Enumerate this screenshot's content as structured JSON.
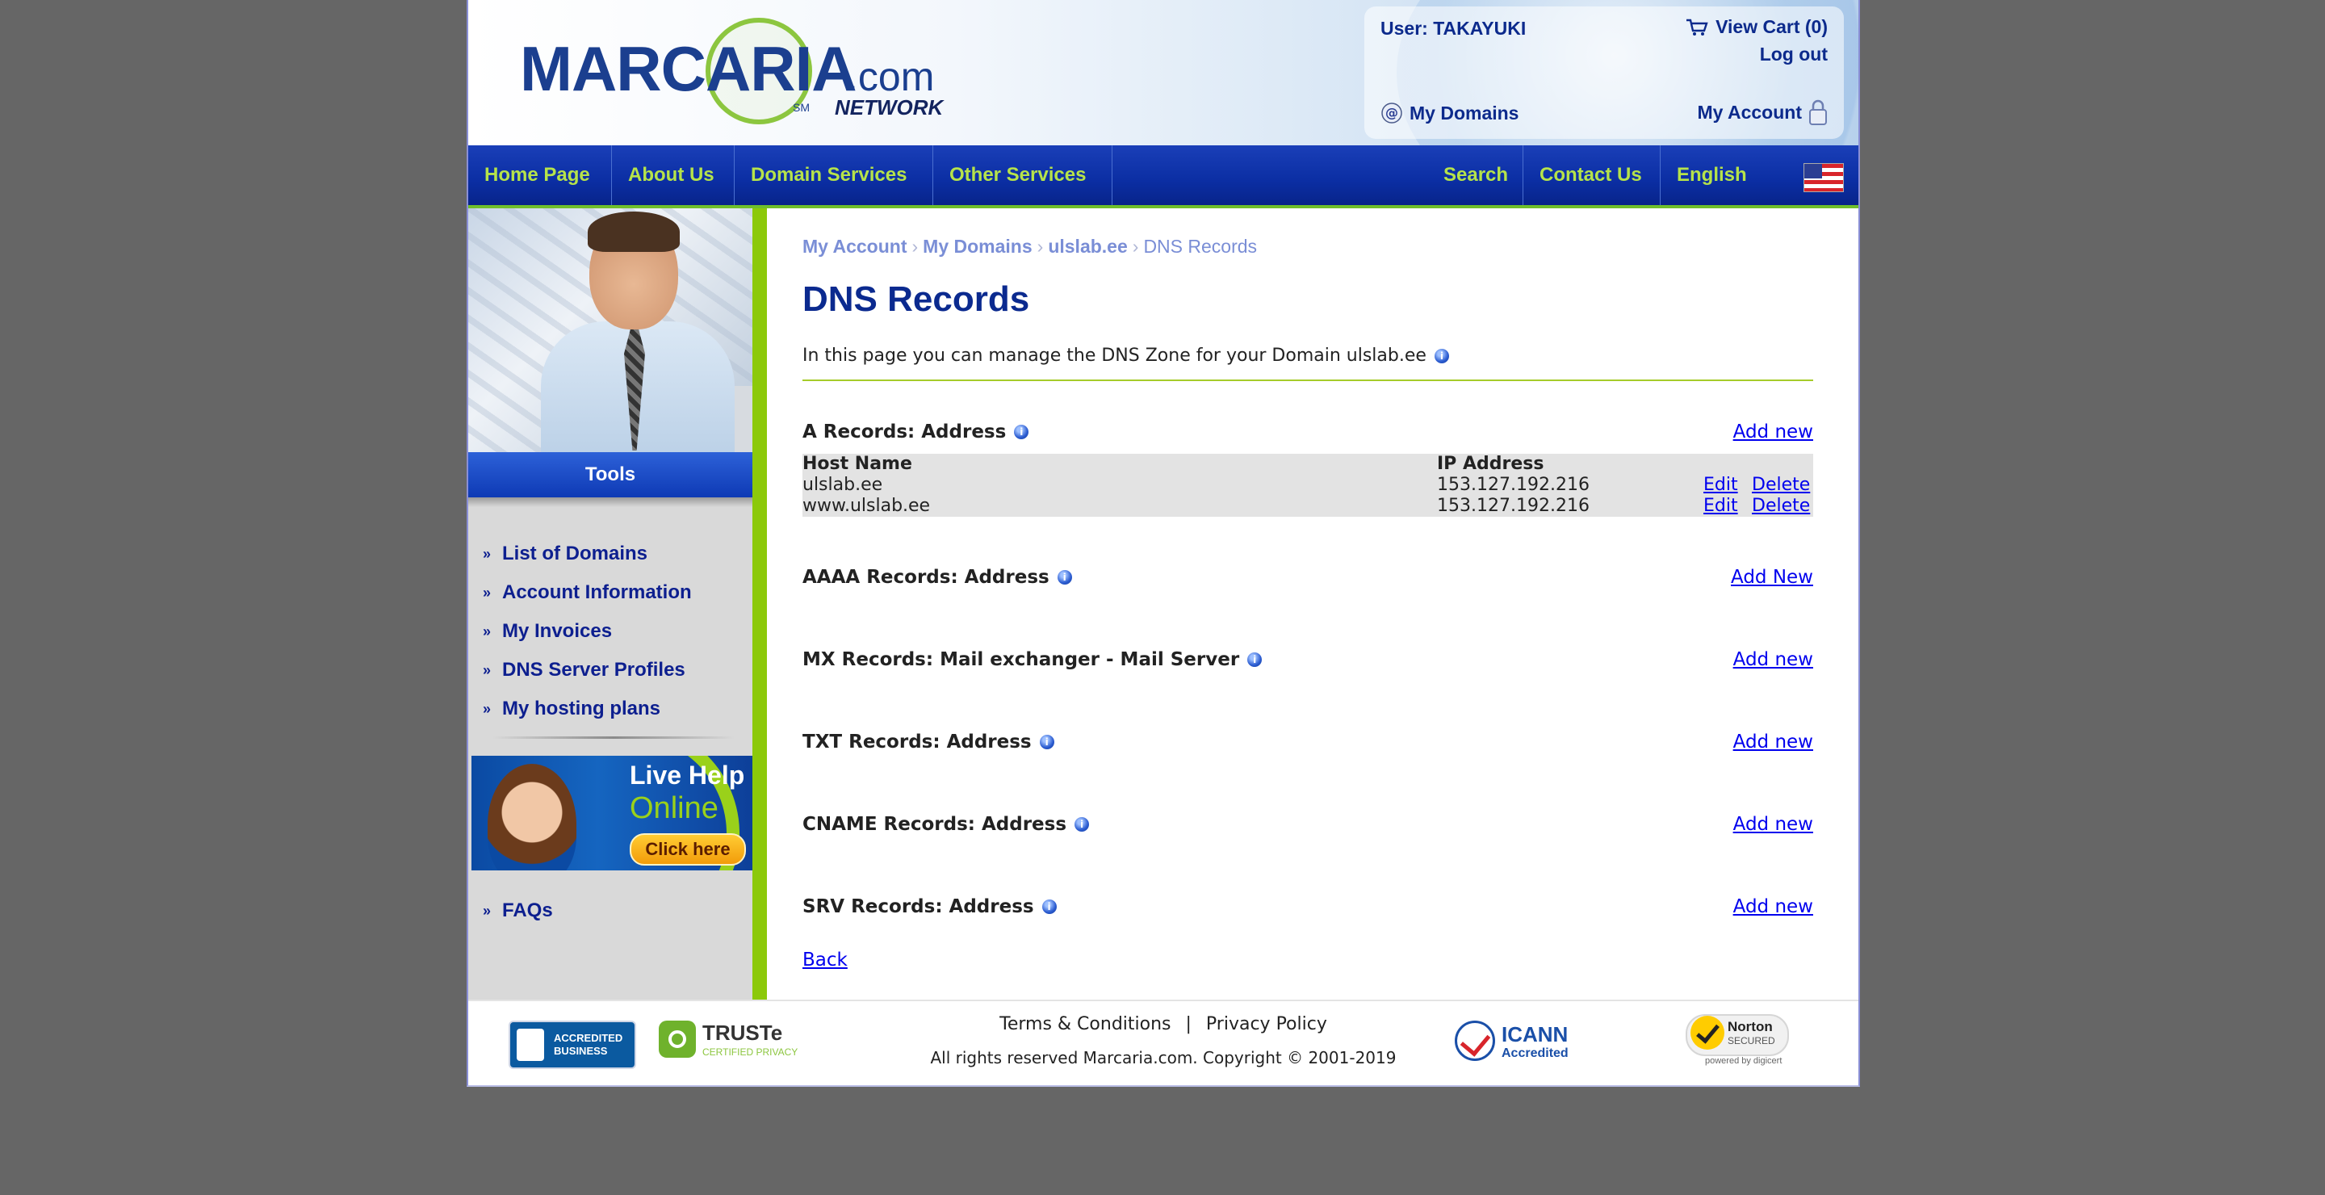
{
  "header": {
    "logo": {
      "text": "MARCARIA",
      "suffix": ".com",
      "network": "NETWORK",
      "sm": "SM"
    },
    "user_label": "User: TAKAYUKI",
    "view_cart": "View Cart (0)",
    "log_out": "Log out",
    "my_domains": "My Domains",
    "my_account": "My Account"
  },
  "nav": {
    "left": [
      "Home Page",
      "About Us",
      "Domain Services",
      "Other Services"
    ],
    "right": [
      "Search",
      "Contact Us",
      "English"
    ]
  },
  "sidebar": {
    "tools_title": "Tools",
    "items": [
      "List of Domains",
      "Account Information",
      "My Invoices",
      "DNS Server Profiles",
      "My hosting plans"
    ],
    "live_help": {
      "line1": "Live Help",
      "line2": "Online",
      "button": "Click here"
    },
    "faqs": "FAQs"
  },
  "content": {
    "breadcrumb": [
      "My Account",
      "My Domains",
      "ulslab.ee",
      "DNS Records"
    ],
    "title": "DNS Records",
    "intro": "In this page you can manage the DNS Zone for your Domain ulslab.ee",
    "sections": [
      {
        "title": "A Records: Address",
        "add": "Add new"
      },
      {
        "title": "AAAA Records: Address",
        "add": "Add New"
      },
      {
        "title": "MX Records: Mail exchanger - Mail Server",
        "add": "Add new"
      },
      {
        "title": "TXT Records: Address",
        "add": "Add new"
      },
      {
        "title": "CNAME Records: Address",
        "add": "Add new"
      },
      {
        "title": "SRV Records: Address",
        "add": "Add new"
      }
    ],
    "a_table": {
      "headers": [
        "Host Name",
        "IP Address"
      ],
      "rows": [
        {
          "host": "ulslab.ee",
          "ip": "153.127.192.216",
          "edit": "Edit",
          "delete": "Delete"
        },
        {
          "host": "www.ulslab.ee",
          "ip": "153.127.192.216",
          "edit": "Edit",
          "delete": "Delete"
        }
      ]
    },
    "back": "Back"
  },
  "footer": {
    "terms": "Terms & Conditions",
    "separator": "|",
    "privacy": "Privacy Policy",
    "copyright": "All rights reserved Marcaria.com. Copyright © 2001-2019",
    "bbb": "ACCREDITED BUSINESS",
    "truste_name": "TRUSTe",
    "truste_sub": "CERTIFIED PRIVACY",
    "icann_name": "ICANN",
    "icann_sub": "Accredited",
    "norton_name": "Norton",
    "norton_sub": "SECURED",
    "norton_powered": "powered by digicert"
  },
  "colors": {
    "nav_bg": "#0b2ea3",
    "nav_text": "#b6e34a",
    "accent_green": "#8cc90a",
    "title_blue": "#0b2a8f",
    "link_blue": "#0000ee"
  }
}
